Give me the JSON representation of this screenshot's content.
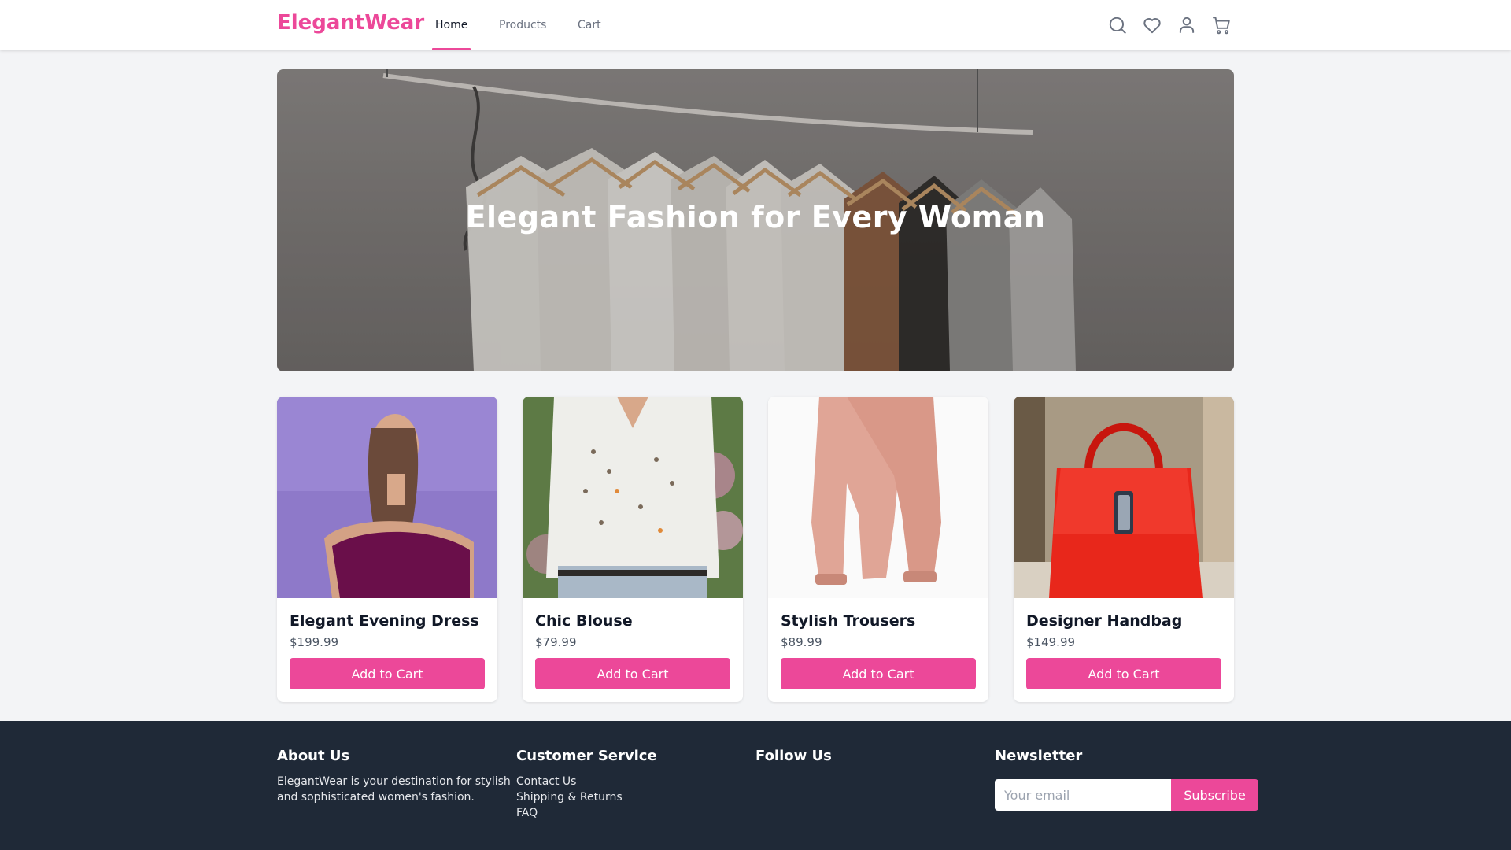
{
  "header": {
    "brand": "ElegantWear",
    "nav": [
      {
        "label": "Home",
        "active": true
      },
      {
        "label": "Products",
        "active": false
      },
      {
        "label": "Cart",
        "active": false
      }
    ],
    "icons": [
      "search-icon",
      "heart-icon",
      "user-icon",
      "cart-icon"
    ]
  },
  "hero": {
    "title": "Elegant Fashion for Every Woman"
  },
  "products": [
    {
      "name": "Elegant Evening Dress",
      "price": "$199.99",
      "button": "Add to Cart"
    },
    {
      "name": "Chic Blouse",
      "price": "$79.99",
      "button": "Add to Cart"
    },
    {
      "name": "Stylish Trousers",
      "price": "$89.99",
      "button": "Add to Cart"
    },
    {
      "name": "Designer Handbag",
      "price": "$149.99",
      "button": "Add to Cart"
    }
  ],
  "footer": {
    "about": {
      "heading": "About Us",
      "text": "ElegantWear is your destination for stylish and sophisticated women's fashion."
    },
    "service": {
      "heading": "Customer Service",
      "links": [
        "Contact Us",
        "Shipping & Returns",
        "FAQ"
      ]
    },
    "follow": {
      "heading": "Follow Us"
    },
    "newsletter": {
      "heading": "Newsletter",
      "placeholder": "Your email",
      "button": "Subscribe"
    }
  },
  "colors": {
    "accent": "#ec4899",
    "footer_bg": "#1f2937",
    "page_bg": "#f3f4f6"
  }
}
